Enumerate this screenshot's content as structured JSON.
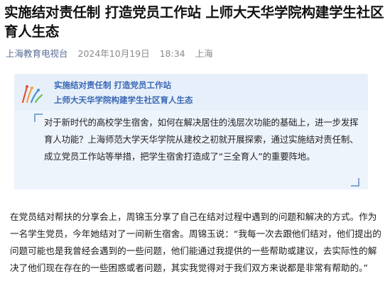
{
  "article": {
    "title": "实施结对责任制 打造党员工作站 上师大天华学院构建学生社区育人生态",
    "source": "上海教育电视台",
    "date": "2024年10月19日",
    "time": "18:34",
    "location": "上海"
  },
  "banner": {
    "line1": "实施结对责任制 打造党员工作站",
    "line2": "上师大天华学院构建学生社区育人生态",
    "logo_icon": "flower-logo-icon"
  },
  "intro": {
    "text": "对于新时代的高校学生宿舍，如何在解决居住的浅层次功能的基础上，进一步发挥育人功能？上海师范大学天华学院从建校之初就开展探索，通过实施结对责任制、 成立党员工作站等举措，把学生宿舍打造成了“三全育人”的重要阵地。"
  },
  "body": {
    "paragraph": "在党员结对帮扶的分享会上，周锦玉分享了自己在结对过程中遇到的问题和解决的方式。作为一名学生党员，今年她结对了一间新生宿舍。周锦玉说：“我每一次去跟他们结对，他们提出的问题可能也是我曾经会遇到的一些问题，他们能通过我提供的一些帮助或建议，去实际性的解决了他们现在存在的一些困惑或者问题，其实我觉得对于我们双方来说都是非常有帮助的。”"
  },
  "colors": {
    "accent": "#3b68b4",
    "source_link": "#576b95",
    "banner_bg": "#e7f0fa",
    "intro_bg": "#eef4fb"
  }
}
